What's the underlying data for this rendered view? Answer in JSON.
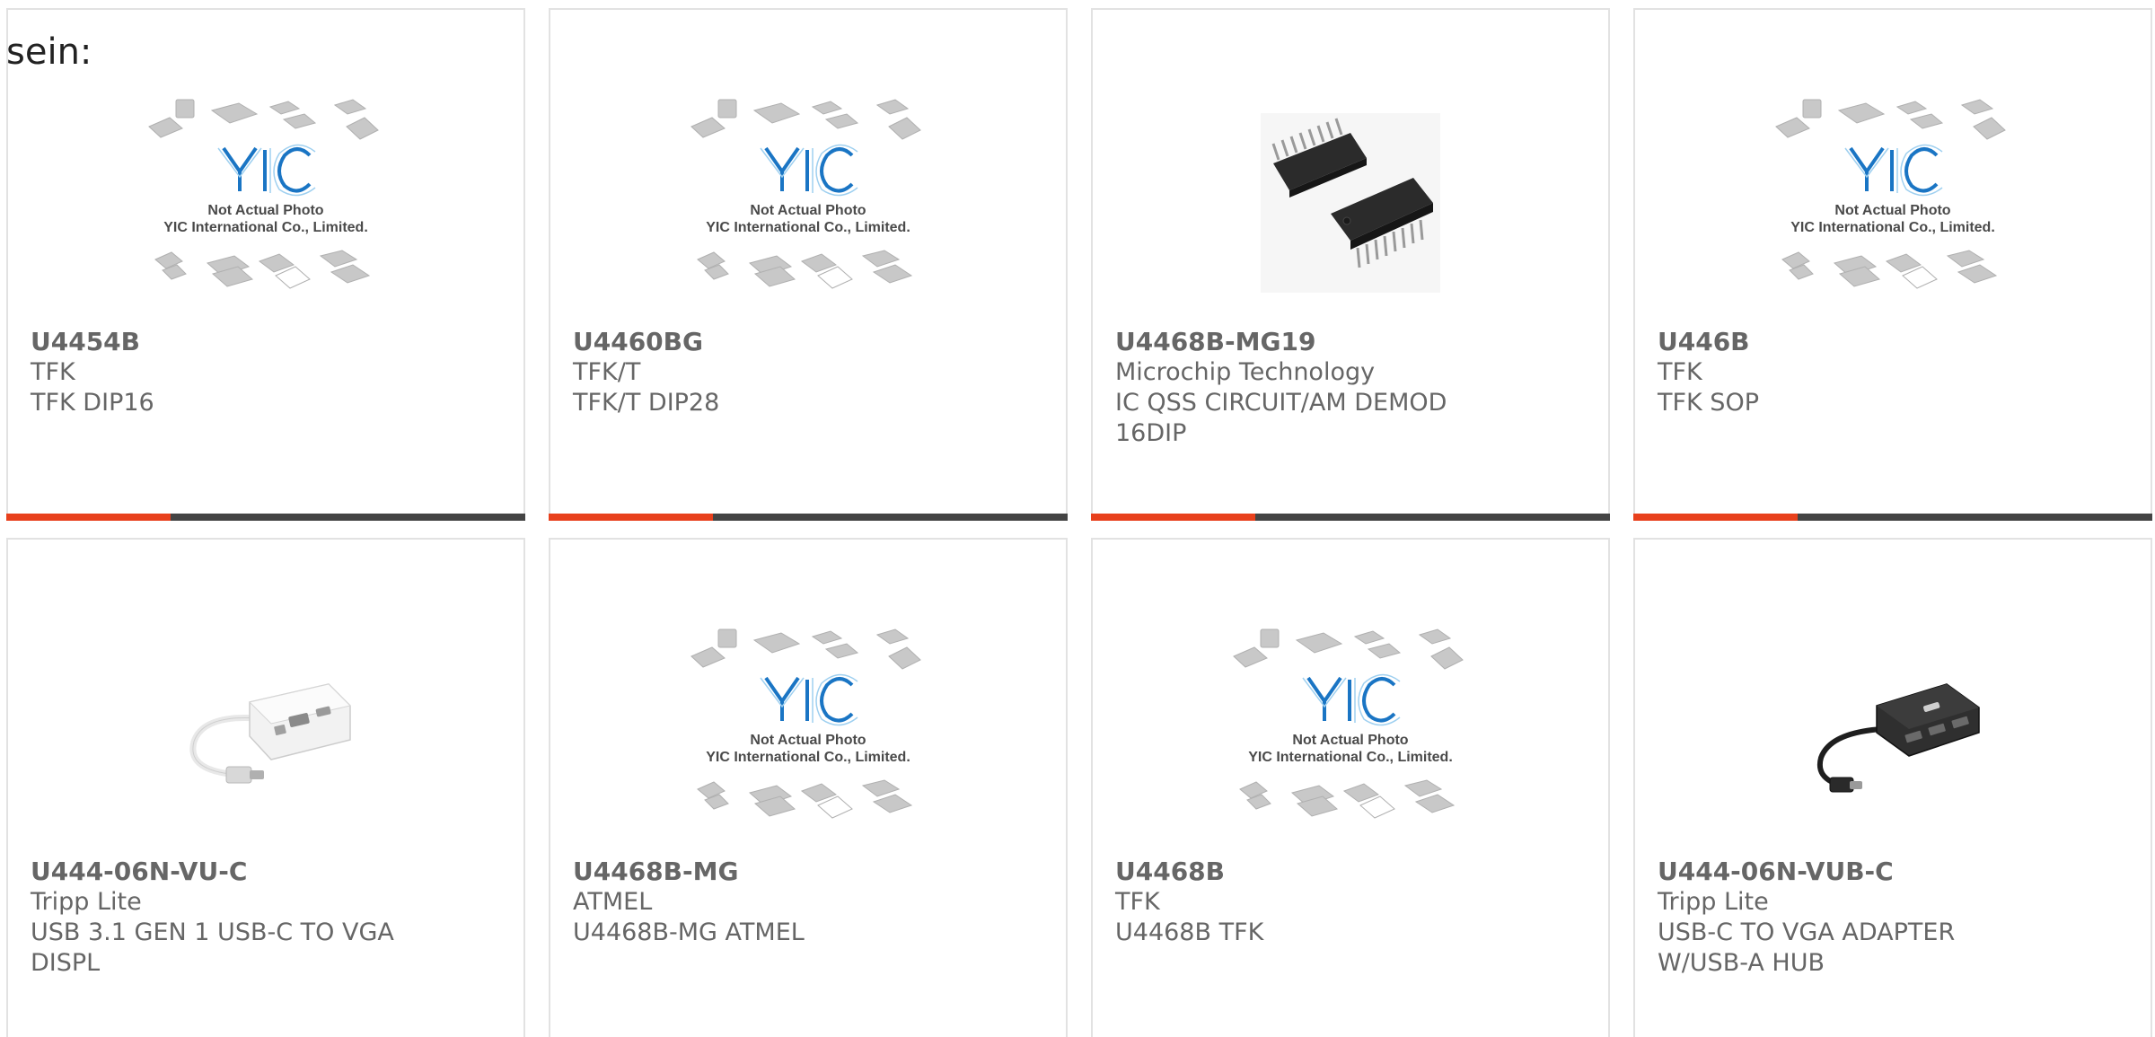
{
  "intro_text": "sein:",
  "placeholder": {
    "logo_text": "YIC",
    "line1": "Not Actual Photo",
    "line2": "YIC International Co., Limited."
  },
  "products": [
    {
      "part": "U4454B",
      "manufacturer": "TFK",
      "description": "TFK DIP16",
      "image": "placeholder-photo"
    },
    {
      "part": "U4460BG",
      "manufacturer": "TFK/T",
      "description": "TFK/T DIP28",
      "image": "placeholder-photo"
    },
    {
      "part": "U4468B-MG19",
      "manufacturer": "Microchip Technology",
      "description": "IC QSS CIRCUIT/AM DEMOD 16DIP",
      "image": "dip-chip-photo"
    },
    {
      "part": "U446B",
      "manufacturer": "TFK",
      "description": "TFK SOP",
      "image": "placeholder-photo"
    },
    {
      "part": "U444-06N-VU-C",
      "manufacturer": "Tripp Lite",
      "description": "USB 3.1 GEN 1 USB-C TO VGA DISPL",
      "image": "white-usb-adapter-photo"
    },
    {
      "part": "U4468B-MG",
      "manufacturer": "ATMEL",
      "description": "U4468B-MG ATMEL",
      "image": "placeholder-photo"
    },
    {
      "part": "U4468B",
      "manufacturer": "TFK",
      "description": "U4468B TFK",
      "image": "placeholder-photo"
    },
    {
      "part": "U444-06N-VUB-C",
      "manufacturer": "Tripp Lite",
      "description": "USB-C TO VGA ADAPTER W/USB-A HUB",
      "image": "black-usb-hub-photo"
    }
  ],
  "colors": {
    "accent_bar": "#e8401c",
    "bar": "#444444",
    "text": "#666666",
    "logo_blue": "#1a75c4"
  }
}
